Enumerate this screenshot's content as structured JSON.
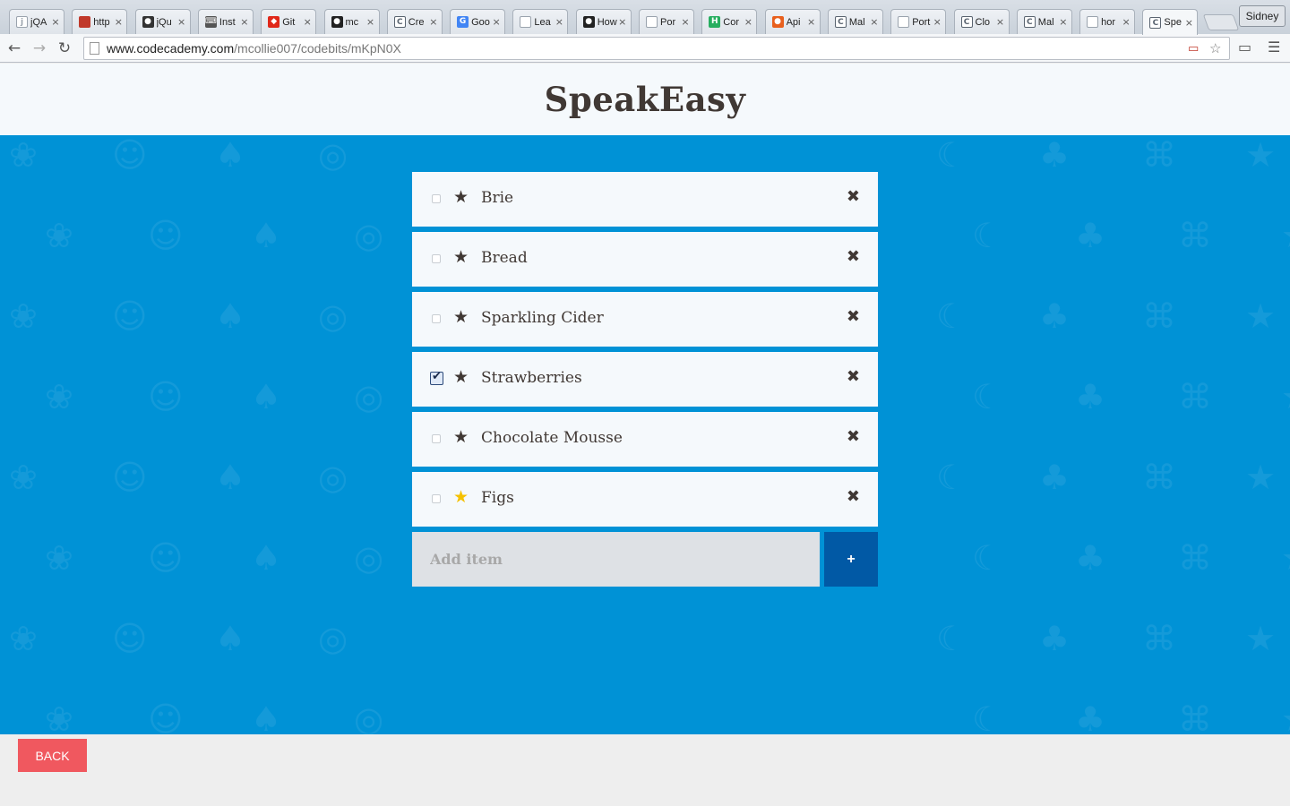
{
  "browser": {
    "tabs": [
      {
        "title": "jQA",
        "icon": "jquery-icon",
        "color": "#9aa3ad",
        "active": false
      },
      {
        "title": "http",
        "icon": "colorful-page-icon",
        "color": "#c0392b",
        "active": false
      },
      {
        "title": "jQu",
        "icon": "github-icon",
        "color": "#333333",
        "active": false
      },
      {
        "title": "Inst",
        "icon": "keyboard-icon",
        "color": "#555555",
        "active": false
      },
      {
        "title": "Git",
        "icon": "git-icon",
        "color": "#e0281a",
        "active": false
      },
      {
        "title": "mc",
        "icon": "github-icon",
        "color": "#222222",
        "active": false
      },
      {
        "title": "Cre",
        "icon": "codecademy-icon",
        "color": "#5a6470",
        "active": false
      },
      {
        "title": "Goo",
        "icon": "google-icon",
        "color": "#4285f4",
        "active": false
      },
      {
        "title": "Lea",
        "icon": "page-icon",
        "color": "#9aa3ad",
        "active": false
      },
      {
        "title": "How",
        "icon": "github-icon",
        "color": "#222222",
        "active": false
      },
      {
        "title": "Por",
        "icon": "page-icon",
        "color": "#9aa3ad",
        "active": false
      },
      {
        "title": "Cor",
        "icon": "hipchat-icon",
        "color": "#27ae60",
        "active": false
      },
      {
        "title": "Api",
        "icon": "api-icon",
        "color": "#e8601e",
        "active": false
      },
      {
        "title": "Mal",
        "icon": "codecademy-icon",
        "color": "#5a6470",
        "active": false
      },
      {
        "title": "Port",
        "icon": "page-icon",
        "color": "#9aa3ad",
        "active": false
      },
      {
        "title": "Clo",
        "icon": "codecademy-icon",
        "color": "#5a6470",
        "active": false
      },
      {
        "title": "Mal",
        "icon": "codecademy-icon",
        "color": "#5a6470",
        "active": false
      },
      {
        "title": "hor",
        "icon": "page-icon",
        "color": "#9aa3ad",
        "active": false
      },
      {
        "title": "Spe",
        "icon": "codecademy-icon",
        "color": "#5a6470",
        "active": true
      }
    ],
    "profile_name": "Sidney",
    "url_host": "www.codecademy.com",
    "url_path": "/mcollie007/codebits/mKpN0X"
  },
  "app": {
    "title": "SpeakEasy"
  },
  "items": [
    {
      "label": "Brie",
      "checked": false,
      "starred_gold": false
    },
    {
      "label": "Bread",
      "checked": false,
      "starred_gold": false
    },
    {
      "label": "Sparkling Cider",
      "checked": false,
      "starred_gold": false
    },
    {
      "label": "Strawberries",
      "checked": true,
      "starred_gold": false
    },
    {
      "label": "Chocolate Mousse",
      "checked": false,
      "starred_gold": false
    },
    {
      "label": "Figs",
      "checked": false,
      "starred_gold": true
    }
  ],
  "add": {
    "placeholder": "Add item",
    "button_label": "+"
  },
  "footer": {
    "back_label": "BACK"
  },
  "colors": {
    "main_bg": "#0092d6",
    "add_button": "#0159a5",
    "back_button": "#f0585f",
    "star_gold": "#f5c100",
    "text_dark": "#403834"
  }
}
